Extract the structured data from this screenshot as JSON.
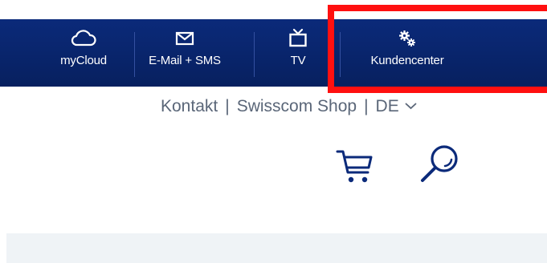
{
  "topnav": {
    "items": [
      {
        "label": "myCloud",
        "icon": "cloud-icon"
      },
      {
        "label": "E-Mail + SMS",
        "icon": "envelope-icon"
      },
      {
        "label": "TV",
        "icon": "tv-icon"
      },
      {
        "label": "Kundencenter",
        "icon": "gears-icon"
      }
    ]
  },
  "utility": {
    "contact": "Kontakt",
    "separator": "|",
    "shop": "Swisscom Shop",
    "language": "DE",
    "language_icon": "chevron-down-icon"
  },
  "actions": {
    "cart_icon": "cart-icon",
    "search_icon": "search-icon"
  },
  "colors": {
    "nav_background": "#0b2a7a",
    "highlight": "#ff1010",
    "utility_text": "#5a6678",
    "icon_blue": "#0b2a7a",
    "panel_background": "#eff3f6"
  }
}
